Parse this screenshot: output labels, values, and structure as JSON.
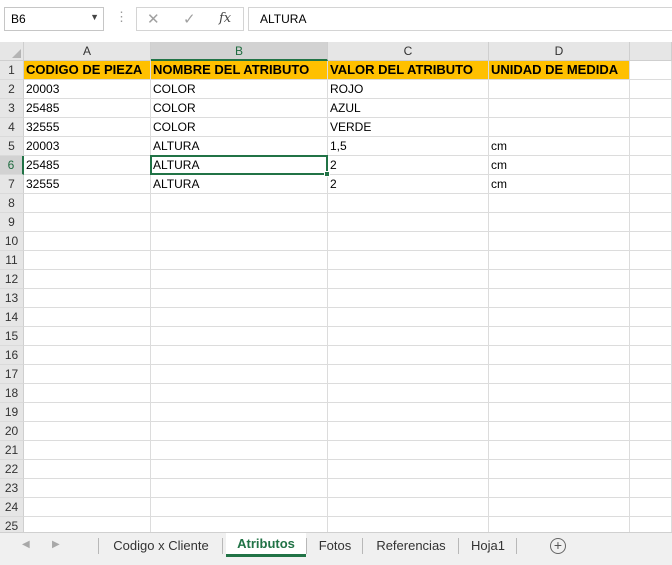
{
  "formula_bar": {
    "name_box": "B6",
    "formula": "ALTURA",
    "cancel_icon": "✕",
    "enter_icon": "✓",
    "fx_label": "fx",
    "dots": "⋮"
  },
  "columns": [
    "A",
    "B",
    "C",
    "D"
  ],
  "rows": [
    "1",
    "2",
    "3",
    "4",
    "5",
    "6",
    "7",
    "8",
    "9",
    "10",
    "11",
    "12",
    "13",
    "14",
    "15",
    "16",
    "17",
    "18",
    "19",
    "20",
    "21",
    "22",
    "23",
    "24",
    "25"
  ],
  "header_cells": [
    "CODIGO DE PIEZA",
    "NOMBRE DEL ATRIBUTO",
    "VALOR DEL ATRIBUTO",
    "UNIDAD DE MEDIDA"
  ],
  "data_rows": [
    [
      "20003",
      "COLOR",
      "ROJO",
      ""
    ],
    [
      "25485",
      "COLOR",
      "AZUL",
      ""
    ],
    [
      "32555",
      "COLOR",
      "VERDE",
      ""
    ],
    [
      "20003",
      "ALTURA",
      "1,5",
      "cm"
    ],
    [
      "25485",
      "ALTURA",
      "2",
      "cm"
    ],
    [
      "32555",
      "ALTURA",
      "2",
      "cm"
    ]
  ],
  "selected_cell": "B6",
  "highlight_color": "#ffc000",
  "accent_color": "#217346",
  "sheet_tabs": [
    {
      "label": "Codigo x Cliente",
      "active": false
    },
    {
      "label": "Atributos",
      "active": true
    },
    {
      "label": "Fotos",
      "active": false
    },
    {
      "label": "Referencias",
      "active": false
    },
    {
      "label": "Hoja1",
      "active": false
    }
  ],
  "nav": {
    "prev": "◀",
    "next": "▶",
    "add_sheet": "+"
  }
}
